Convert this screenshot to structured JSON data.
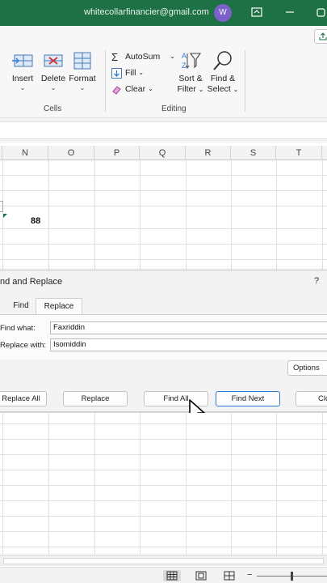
{
  "titlebar": {
    "account_email": "whitecollarfinancier@gmail.com",
    "avatar_initial": "W"
  },
  "ribbon": {
    "cells_group": {
      "label": "Cells",
      "insert": "Insert",
      "delete": "Delete",
      "format": "Format"
    },
    "editing_group": {
      "label": "Editing",
      "autosum": "AutoSum",
      "fill": "Fill",
      "clear": "Clear",
      "sort_filter_line1": "Sort &",
      "sort_filter_line2": "Filter",
      "find_select_line1": "Find &",
      "find_select_line2": "Select"
    }
  },
  "grid": {
    "columns": [
      "N",
      "O",
      "P",
      "Q",
      "R",
      "S",
      "T"
    ],
    "cell_value": "88"
  },
  "dialog": {
    "title": "nd and Replace",
    "help": "?",
    "tabs": [
      "Find",
      "Replace"
    ],
    "active_tab": "Replace",
    "find_what_label": "Find what:",
    "find_what_value": "Faxriddin",
    "replace_with_label": "Replace with:",
    "replace_with_value": "Isomiddin",
    "options_button": "Options",
    "buttons": {
      "replace_all": "Replace All",
      "replace": "Replace",
      "find_all": "Find All",
      "find_next": "Find Next",
      "close": "Close"
    }
  },
  "colors": {
    "title_bar": "#1e7145",
    "accent_blue": "#2e7bd6",
    "avatar": "#7b61c9"
  }
}
